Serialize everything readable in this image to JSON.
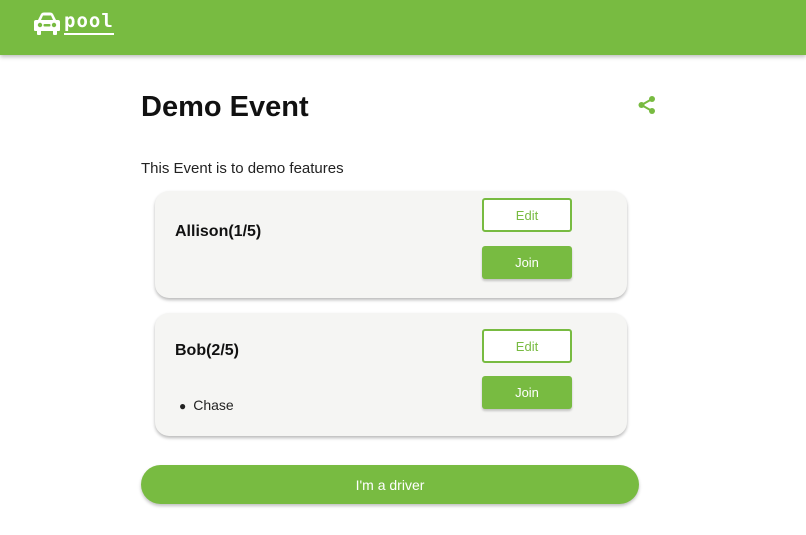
{
  "header": {
    "app_name": "pool",
    "logo_icon": "car-icon",
    "color": "#78bb41"
  },
  "event": {
    "title": "Demo Event",
    "description": "This Event is to demo features",
    "share_icon": "share-icon"
  },
  "cars": [
    {
      "driver": "Allison(1/5)",
      "edit_label": "Edit",
      "join_label": "Join",
      "passengers": []
    },
    {
      "driver": "Bob(2/5)",
      "edit_label": "Edit",
      "join_label": "Join",
      "passengers": [
        "Chase"
      ]
    }
  ],
  "actions": {
    "driver_label": "I'm a driver"
  }
}
